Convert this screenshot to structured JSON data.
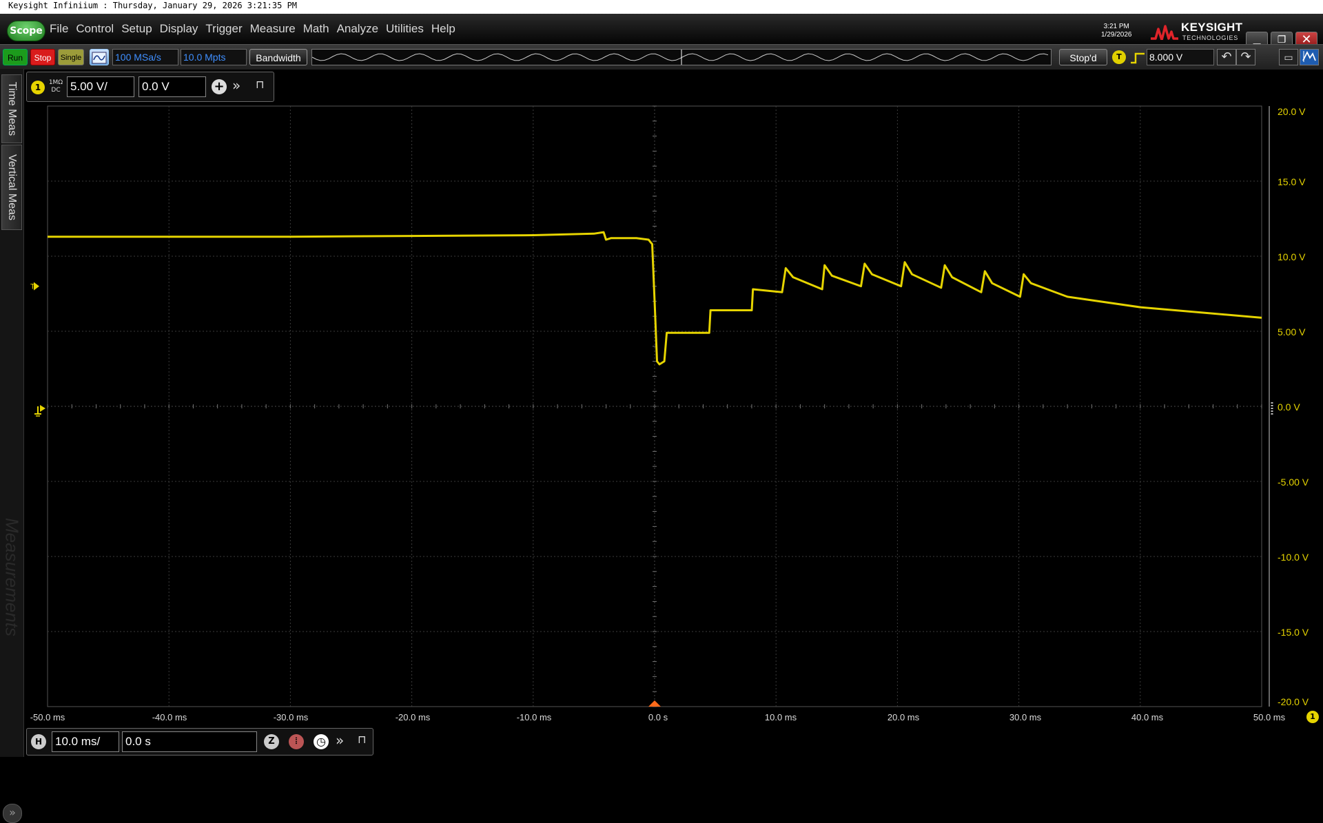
{
  "window_title": "Keysight Infiniium : Thursday, January 29, 2026 3:21:35 PM",
  "menubar": {
    "scope_label": "Scope",
    "items": [
      "File",
      "Control",
      "Setup",
      "Display",
      "Trigger",
      "Measure",
      "Math",
      "Analyze",
      "Utilities",
      "Help"
    ],
    "clock_time": "3:21 PM",
    "clock_date": "1/29/2026",
    "brand_name": "KEYSIGHT",
    "brand_sub": "TECHNOLOGIES"
  },
  "toolbar": {
    "run_label": "Run",
    "stop_label": "Stop",
    "single_label": "Single",
    "sample_rate": "100 MSa/s",
    "memory_depth": "10.0 Mpts",
    "bandwidth_label": "Bandwidth",
    "status_label": "Stop'd",
    "trigger_badge": "T",
    "trigger_level": "8.000 V"
  },
  "side_tabs": [
    "Time Meas",
    "Vertical Meas"
  ],
  "measurements_watermark": "Measurements",
  "channel1": {
    "badge": "1",
    "impedance": "1MΩ",
    "coupling": "DC",
    "scale": "5.00 V/",
    "offset": "0.0 V"
  },
  "horizontal": {
    "badge": "H",
    "scale": "10.0 ms/",
    "position": "0.0 s"
  },
  "trigger_marker_label": "T",
  "colors": {
    "trace": "#e6d400",
    "grid": "#3c3c3c",
    "trigger_arrow": "#ff6a1a"
  },
  "axis": {
    "volt_ticks": [
      "20.0 V",
      "15.0 V",
      "10.0 V",
      "5.00 V",
      "0.0 V",
      "-5.00 V",
      "-10.0 V",
      "-15.0 V",
      "-20.0 V"
    ],
    "time_ticks": [
      "-50.0 ms",
      "-40.0 ms",
      "-30.0 ms",
      "-20.0 ms",
      "-10.0 ms",
      "0.0 s",
      "10.0 ms",
      "20.0 ms",
      "30.0 ms",
      "40.0 ms",
      "50.0 ms"
    ],
    "channel_indicator": "1"
  },
  "chart_data": {
    "type": "line",
    "title": "",
    "xlabel": "",
    "ylabel": "",
    "xlim_ms": [
      -50,
      50
    ],
    "ylim_V": [
      -20,
      20
    ],
    "grid": true,
    "series": [
      {
        "x": [
          -50,
          -40,
          -30,
          -20,
          -10,
          -5,
          -4.2,
          -4.0,
          -3.6,
          -1.5,
          -0.5,
          -0.2,
          0.0,
          0.2,
          0.4,
          0.8,
          1.0,
          4.5,
          4.6,
          8.0,
          8.1,
          10.5,
          10.8,
          11.4,
          13.8,
          14.0,
          14.6,
          17.0,
          17.3,
          17.9,
          20.3,
          20.6,
          21.2,
          23.6,
          23.9,
          24.5,
          26.9,
          27.2,
          27.8,
          30.1,
          30.4,
          31.0,
          34.0,
          40.0,
          50.0
        ],
        "y": [
          11.3,
          11.3,
          11.3,
          11.35,
          11.4,
          11.5,
          11.6,
          11.1,
          11.2,
          11.2,
          11.1,
          10.8,
          7.0,
          3.0,
          2.8,
          3.0,
          4.9,
          4.9,
          6.4,
          6.4,
          7.8,
          7.6,
          9.2,
          8.6,
          7.8,
          9.4,
          8.7,
          8.0,
          9.5,
          8.8,
          8.0,
          9.6,
          8.8,
          7.9,
          9.4,
          8.6,
          7.6,
          9.0,
          8.2,
          7.3,
          8.8,
          8.2,
          7.3,
          6.6,
          5.9
        ]
      }
    ]
  }
}
